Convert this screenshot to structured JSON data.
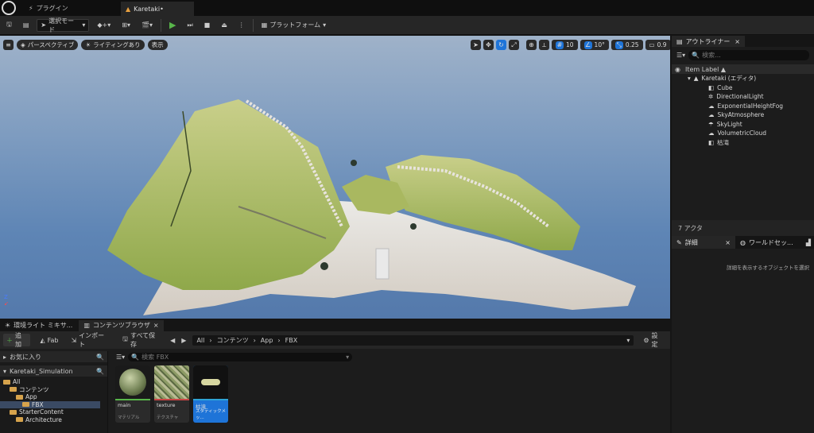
{
  "window": {
    "plugins_label": "プラグイン",
    "document_tab": "Karetaki•"
  },
  "toolbar": {
    "select_mode": "選択モード",
    "platform": "プラットフォーム"
  },
  "viewport": {
    "perspective": "パースペクティブ",
    "lighting": "ライティングあり",
    "show": "表示",
    "grid_snap": "10",
    "rotation_snap": "10°",
    "scale_snap": "0.25",
    "camera_speed": "0.9"
  },
  "outliner": {
    "tab": "アウトライナー",
    "search_placeholder": "検索...",
    "column": "Item Label ▲",
    "root": "Karetaki (エディタ)",
    "items": [
      "Cube",
      "DirectionalLight",
      "ExponentialHeightFog",
      "SkyAtmosphere",
      "SkyLight",
      "VolumetricCloud",
      "枯滝"
    ],
    "actor_count": "7 アクタ"
  },
  "details": {
    "tab": "詳細",
    "world_tab": "ワールドセッ...",
    "empty_msg": "詳細を表示するオブジェクトを選択"
  },
  "bottom": {
    "env_tab": "環境ライト ミキサ...",
    "cb_tab": "コンテンツブラウザ",
    "add": "追加",
    "fab": "Fab",
    "import": "インポート",
    "save_all": "すべて保存",
    "path": [
      "All",
      "コンテンツ",
      "App",
      "FBX"
    ],
    "settings": "設定",
    "favorites": "お気に入り",
    "project": "Karetaki_Simulation",
    "tree": [
      "All",
      "コンテンツ",
      "App",
      "FBX",
      "StarterContent",
      "Architecture"
    ],
    "search_placeholder": "検索 FBX",
    "assets": [
      {
        "name": "main",
        "type": "マテリアル"
      },
      {
        "name": "texture",
        "type": "テクスチャ"
      },
      {
        "name": "枯滝",
        "type": "スタティックメッ..."
      }
    ]
  },
  "colors": {
    "accent": "#1e74d8",
    "play": "#58b54a",
    "folder": "#d6a34c"
  }
}
